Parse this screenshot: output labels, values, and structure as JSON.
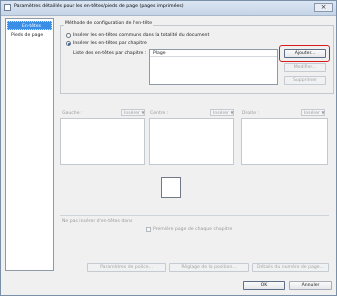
{
  "window": {
    "title": "Paramètres détaillés pour les en-têtes/pieds de page (pages imprimées)",
    "close_glyph": "×"
  },
  "sidebar": {
    "items": [
      {
        "label": "En-têtes",
        "selected": true
      },
      {
        "label": "Pieds de page",
        "selected": false
      }
    ]
  },
  "method_group": {
    "title": "Méthode de configuration de l'en-tête",
    "options": [
      {
        "label": "Insérer les en-têtes communs dans la totalité du document",
        "checked": false
      },
      {
        "label": "Insérer les en-têtes par chapitre",
        "checked": true
      }
    ],
    "list_label": "Liste des en-têtes par chapitre :",
    "list_column": "Plage",
    "buttons": {
      "add": "Ajouter...",
      "modify": "Modifier...",
      "delete": "Supprimer"
    }
  },
  "sections": {
    "left": "Gauche :",
    "center": "Centre :",
    "right": "Droite :",
    "insert": "Insérer",
    "arrow": "▼"
  },
  "exclusion": {
    "label": "Ne pas insérer d'en-têtes dans",
    "first_page": "Première page de chaque chapitre"
  },
  "bottom_buttons": {
    "font": "Paramètres de police...",
    "position": "Réglage de la position...",
    "page_number": "Détails du numéro de page..."
  },
  "dialog": {
    "ok": "OK",
    "cancel": "Annuler"
  },
  "colors": {
    "selection": "#3b8ee6",
    "highlight": "#d81b1b"
  }
}
